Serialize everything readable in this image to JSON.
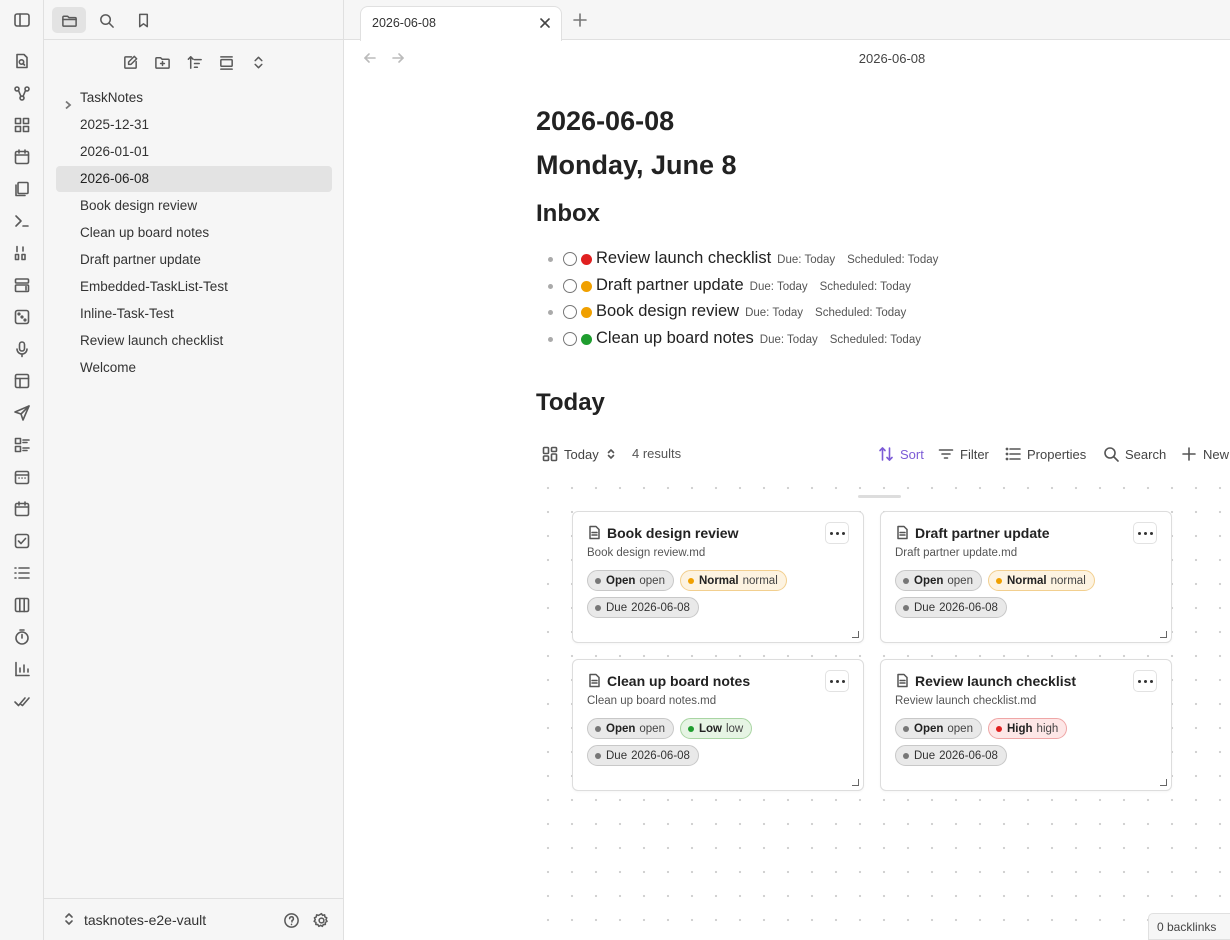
{
  "ribbon": {
    "icons": [
      "open-quick-switcher-icon",
      "graph-view-icon",
      "canvas-icon",
      "daily-note-icon",
      "templates-icon",
      "command-palette-icon",
      "number-list-icon",
      "new-base-icon",
      "random-note-icon",
      "audio-recorder-icon",
      "layout-icon",
      "publish-icon",
      "dashboard-icon",
      "calendar-icon",
      "calendar-alt-icon",
      "task-checkbox-icon",
      "task-list-icon",
      "kanban-icon",
      "pomodoro-timer-icon",
      "stats-chart-icon",
      "check-all-icon"
    ]
  },
  "sidebar": {
    "tree": [
      {
        "label": "TaskNotes",
        "folder": true
      },
      {
        "label": "2025-12-31"
      },
      {
        "label": "2026-01-01"
      },
      {
        "label": "2026-06-08",
        "active": true
      },
      {
        "label": "Book design review"
      },
      {
        "label": "Clean up board notes"
      },
      {
        "label": "Draft partner update"
      },
      {
        "label": "Embedded-TaskList-Test"
      },
      {
        "label": "Inline-Task-Test"
      },
      {
        "label": "Review launch checklist"
      },
      {
        "label": "Welcome"
      }
    ],
    "vault_name": "tasknotes-e2e-vault"
  },
  "tab": {
    "title": "2026-06-08"
  },
  "view": {
    "title": "2026-06-08"
  },
  "note": {
    "heading1": "2026-06-08",
    "heading2": "Monday, June 8",
    "inbox_heading": "Inbox",
    "today_heading": "Today",
    "inbox_tasks": [
      {
        "title": "Review launch checklist",
        "priority_color": "#e02020",
        "due": "Due: Today",
        "scheduled": "Scheduled: Today"
      },
      {
        "title": "Draft partner update",
        "priority_color": "#f0a000",
        "due": "Due: Today",
        "scheduled": "Scheduled: Today"
      },
      {
        "title": "Book design review",
        "priority_color": "#f0a000",
        "due": "Due: Today",
        "scheduled": "Scheduled: Today"
      },
      {
        "title": "Clean up board notes",
        "priority_color": "#1f9d2f",
        "due": "Due: Today",
        "scheduled": "Scheduled: Today"
      }
    ]
  },
  "base": {
    "view_name": "Today",
    "results": "4 results",
    "sort_label": "Sort",
    "filter_label": "Filter",
    "properties_label": "Properties",
    "search_label": "Search",
    "new_label": "New",
    "cards": [
      {
        "title": "Book design review",
        "file": "Book design review.md",
        "status_label": "Open",
        "status_value": "open",
        "priority_label": "Normal",
        "priority_value": "normal",
        "priority_class": "normal",
        "priority_color": "#f0a000",
        "due_label": "Due",
        "due_value": "2026-06-08"
      },
      {
        "title": "Draft partner update",
        "file": "Draft partner update.md",
        "status_label": "Open",
        "status_value": "open",
        "priority_label": "Normal",
        "priority_value": "normal",
        "priority_class": "normal",
        "priority_color": "#f0a000",
        "due_label": "Due",
        "due_value": "2026-06-08"
      },
      {
        "title": "Clean up board notes",
        "file": "Clean up board notes.md",
        "status_label": "Open",
        "status_value": "open",
        "priority_label": "Low",
        "priority_value": "low",
        "priority_class": "low",
        "priority_color": "#1f9d2f",
        "due_label": "Due",
        "due_value": "2026-06-08"
      },
      {
        "title": "Review launch checklist",
        "file": "Review launch checklist.md",
        "status_label": "Open",
        "status_value": "open",
        "priority_label": "High",
        "priority_value": "high",
        "priority_class": "high",
        "priority_color": "#e02020",
        "due_label": "Due",
        "due_value": "2026-06-08"
      }
    ]
  },
  "status_bar": {
    "backlinks": "0 backlinks"
  }
}
